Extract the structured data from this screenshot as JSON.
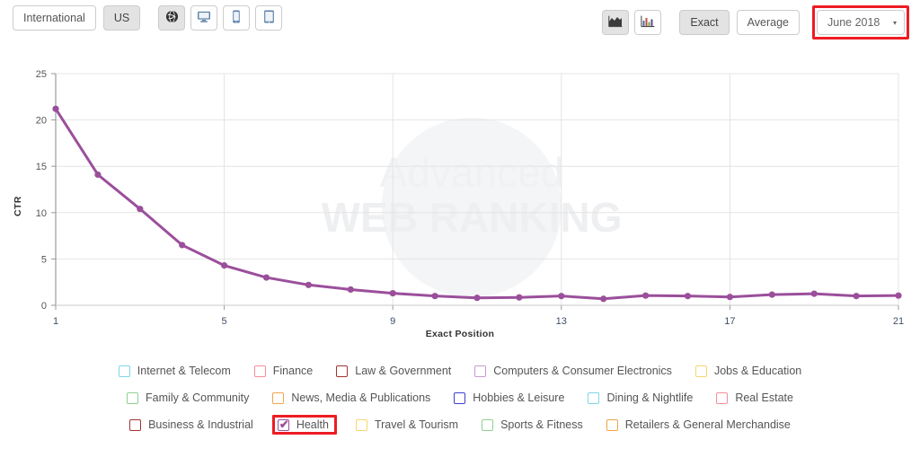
{
  "toolbar": {
    "left_buttons": [
      {
        "label": "International",
        "name": "international-button",
        "active": false
      },
      {
        "label": "US",
        "name": "us-button",
        "active": true
      }
    ],
    "device_buttons": [
      {
        "icon": "globe-icon",
        "name": "device-all-button",
        "active": true
      },
      {
        "icon": "desktop-icon",
        "name": "device-desktop-button",
        "active": false
      },
      {
        "icon": "mobile-icon",
        "name": "device-mobile-button",
        "active": false
      },
      {
        "icon": "tablet-icon",
        "name": "device-tablet-button",
        "active": false
      }
    ],
    "chart_type_buttons": [
      {
        "icon": "area-chart-icon",
        "name": "chart-type-area-button",
        "active": true
      },
      {
        "icon": "bar-chart-icon",
        "name": "chart-type-bar-button",
        "active": false
      }
    ],
    "mode_buttons": [
      {
        "label": "Exact",
        "name": "exact-button",
        "active": true
      },
      {
        "label": "Average",
        "name": "average-button",
        "active": false
      }
    ],
    "date_dropdown": {
      "value": "June 2018",
      "caret": "▾"
    },
    "highlight_color": "#ee1c23"
  },
  "watermark": {
    "line1": "Advanced",
    "line2": "WEB RANKING"
  },
  "chart_data": {
    "type": "line",
    "title": "",
    "xlabel": "Exact Position",
    "ylabel": "CTR",
    "xlim": [
      1,
      21
    ],
    "ylim": [
      0,
      25
    ],
    "xticks": [
      1,
      5,
      9,
      13,
      17,
      21
    ],
    "yticks": [
      0,
      5,
      10,
      15,
      20,
      25
    ],
    "grid": true,
    "legend_position": "bottom",
    "line_color": "#9b4f9b",
    "x": [
      1,
      2,
      3,
      4,
      5,
      6,
      7,
      8,
      9,
      10,
      11,
      12,
      13,
      14,
      15,
      16,
      17,
      18,
      19,
      20,
      21
    ],
    "series": [
      {
        "name": "Health",
        "color": "#9b4f9b",
        "values": [
          21.2,
          14.1,
          10.4,
          6.5,
          4.3,
          3.0,
          2.2,
          1.7,
          1.3,
          1.0,
          0.8,
          0.85,
          1.0,
          0.7,
          1.05,
          1.0,
          0.9,
          1.15,
          1.25,
          1.0,
          1.05
        ]
      }
    ]
  },
  "legend": {
    "rows": [
      [
        {
          "label": "Internet & Telecom",
          "color": "#7ed6e8",
          "checked": false,
          "highlighted": false
        },
        {
          "label": "Finance",
          "color": "#f58d9b",
          "checked": false,
          "highlighted": false
        },
        {
          "label": "Law & Government",
          "color": "#a13232",
          "checked": false,
          "highlighted": false
        },
        {
          "label": "Computers & Consumer Electronics",
          "color": "#c39bd3",
          "checked": false,
          "highlighted": false
        },
        {
          "label": "Jobs & Education",
          "color": "#f5d76e",
          "checked": false,
          "highlighted": false
        }
      ],
      [
        {
          "label": "Family & Community",
          "color": "#8fd18f",
          "checked": false,
          "highlighted": false
        },
        {
          "label": "News, Media & Publications",
          "color": "#f0a44a",
          "checked": false,
          "highlighted": false
        },
        {
          "label": "Hobbies & Leisure",
          "color": "#3f3fd0",
          "checked": false,
          "highlighted": false
        },
        {
          "label": "Dining & Nightlife",
          "color": "#7ed6e8",
          "checked": false,
          "highlighted": false
        },
        {
          "label": "Real Estate",
          "color": "#f58d9b",
          "checked": false,
          "highlighted": false
        }
      ],
      [
        {
          "label": "Business & Industrial",
          "color": "#a13232",
          "checked": false,
          "highlighted": false
        },
        {
          "label": "Health",
          "color": "#9b4f9b",
          "checked": true,
          "highlighted": true
        },
        {
          "label": "Travel & Tourism",
          "color": "#f5d76e",
          "checked": false,
          "highlighted": false
        },
        {
          "label": "Sports & Fitness",
          "color": "#8fd18f",
          "checked": false,
          "highlighted": false
        },
        {
          "label": "Retailers & General Merchandise",
          "color": "#f0a44a",
          "checked": false,
          "highlighted": false
        }
      ]
    ],
    "check_glyph": "✔"
  }
}
